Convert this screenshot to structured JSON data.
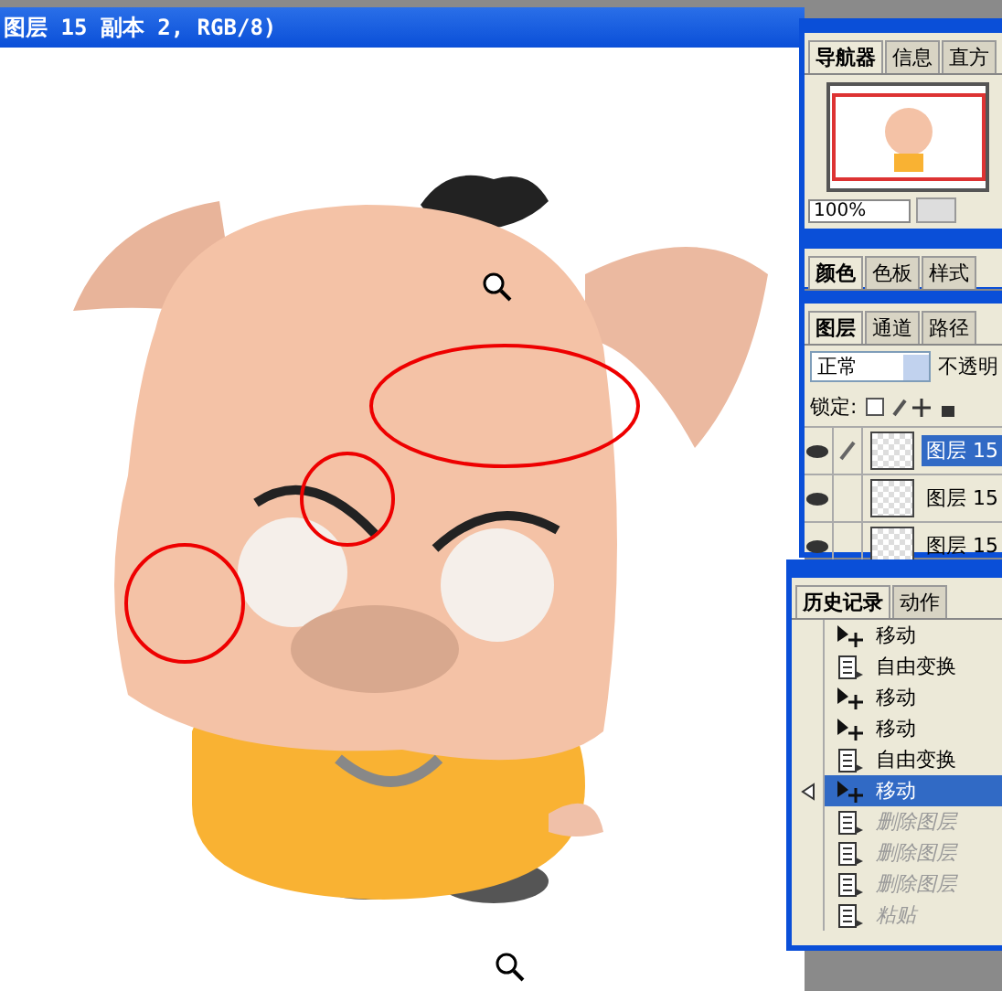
{
  "document": {
    "title": "图层 15 副本 2, RGB/8)"
  },
  "navigator": {
    "tabs": [
      {
        "label": "导航器",
        "selected": true
      },
      {
        "label": "信息",
        "selected": false
      },
      {
        "label": "直方",
        "selected": false
      }
    ],
    "zoom": "100%"
  },
  "color_panel": {
    "tabs": [
      {
        "label": "颜色",
        "selected": true
      },
      {
        "label": "色板",
        "selected": false
      },
      {
        "label": "样式",
        "selected": false
      }
    ]
  },
  "layers": {
    "tabs": [
      {
        "label": "图层",
        "selected": true
      },
      {
        "label": "通道",
        "selected": false
      },
      {
        "label": "路径",
        "selected": false
      }
    ],
    "blend_mode": "正常",
    "opacity_label": "不透明",
    "lock_label": "锁定:",
    "items": [
      {
        "name": "图层 15",
        "selected": true,
        "visible": true
      },
      {
        "name": "图层 15",
        "selected": false,
        "visible": true
      },
      {
        "name": "图层 15",
        "selected": false,
        "visible": true
      }
    ]
  },
  "history": {
    "tabs": [
      {
        "label": "历史记录",
        "selected": true
      },
      {
        "label": "动作",
        "selected": false
      }
    ],
    "items": [
      {
        "label": "移动",
        "kind": "move",
        "selected": false,
        "undone": false
      },
      {
        "label": "自由变换",
        "kind": "transform",
        "selected": false,
        "undone": false
      },
      {
        "label": "移动",
        "kind": "move",
        "selected": false,
        "undone": false
      },
      {
        "label": "移动",
        "kind": "move",
        "selected": false,
        "undone": false
      },
      {
        "label": "自由变换",
        "kind": "transform",
        "selected": false,
        "undone": false
      },
      {
        "label": "移动",
        "kind": "move",
        "selected": true,
        "undone": false
      },
      {
        "label": "删除图层",
        "kind": "transform",
        "selected": false,
        "undone": true
      },
      {
        "label": "删除图层",
        "kind": "transform",
        "selected": false,
        "undone": true
      },
      {
        "label": "删除图层",
        "kind": "transform",
        "selected": false,
        "undone": true
      },
      {
        "label": "粘贴",
        "kind": "transform",
        "selected": false,
        "undone": true
      }
    ]
  }
}
